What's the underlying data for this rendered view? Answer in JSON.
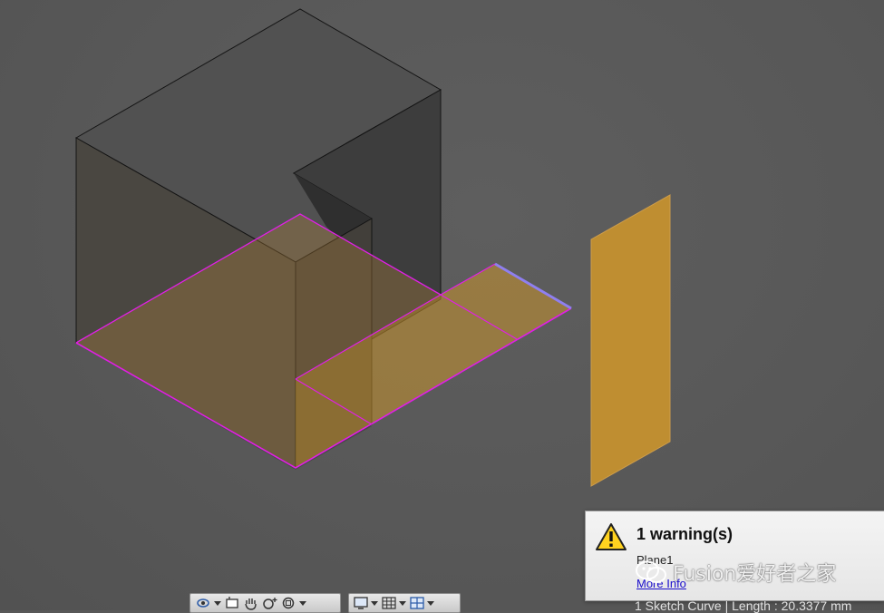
{
  "warning": {
    "title": "1 warning(s)",
    "item": "Plane1",
    "link": "More Info"
  },
  "watermark": {
    "text": "Fusion爱好者之家"
  },
  "status_bar": {
    "text": "1 Sketch Curve | Length : 20.3377 mm"
  },
  "toolbar": {
    "buttons": [
      "orbit-icon",
      "look-at-icon",
      "pan-icon",
      "zoom-icon",
      "fit-icon",
      "display-settings-icon",
      "grid-icon",
      "viewports-icon"
    ]
  },
  "colors": {
    "canvas": "#585858",
    "body_dark": "#444444",
    "sketch_magenta": "#e01fe6",
    "plane_orange": "#c8932e",
    "selected_edge": "#8f7ff0",
    "warning_bg": "#efefef",
    "link": "#1a0dcc"
  }
}
